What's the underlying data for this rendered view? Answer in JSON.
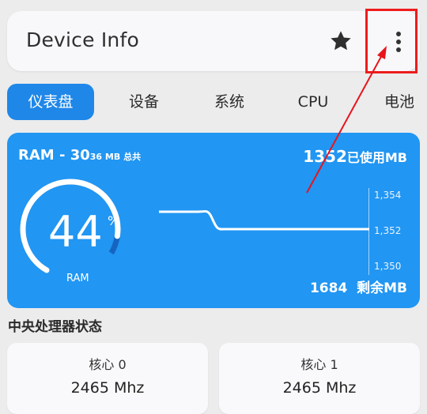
{
  "appbar": {
    "title": "Device Info",
    "star_icon": "star-icon",
    "more_icon": "more-vert-icon"
  },
  "tabs": [
    {
      "label": "仪表盘",
      "active": true
    },
    {
      "label": "设备",
      "active": false
    },
    {
      "label": "系统",
      "active": false
    },
    {
      "label": "CPU",
      "active": false
    },
    {
      "label": "电池",
      "active": false
    }
  ],
  "ram": {
    "title_prefix": "RAM - 30",
    "title_small": "36 MB 总共",
    "used_value": "1352",
    "used_unit": "已使用MB",
    "percent_value": "44",
    "percent_sign": "%",
    "gauge_label": "RAM",
    "gauge_fraction": 0.44,
    "free_value": "1684",
    "free_unit": "剩余MB",
    "ticks": [
      "1,354",
      "1,352",
      "1,350"
    ]
  },
  "cpu_section": {
    "title": "中央处理器状态",
    "cores": [
      {
        "label": "核心 0",
        "freq": "2465 Mhz"
      },
      {
        "label": "核心 1",
        "freq": "2465 Mhz"
      }
    ]
  },
  "colors": {
    "accent": "#2196f3",
    "active_tab": "#1f87e8",
    "highlight": "#ee1c1c"
  }
}
